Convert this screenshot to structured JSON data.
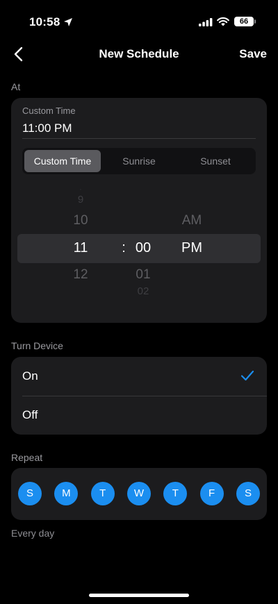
{
  "status": {
    "time": "10:58",
    "battery": "66"
  },
  "nav": {
    "title": "New Schedule",
    "save": "Save"
  },
  "at": {
    "section_label": "At",
    "field_label": "Custom Time",
    "field_value": "11:00 PM",
    "segments": [
      "Custom Time",
      "Sunrise",
      "Sunset"
    ],
    "selected_segment": 0,
    "picker": {
      "hours": [
        "9",
        "10",
        "11",
        "12"
      ],
      "minutes": [
        "00",
        "01",
        "02"
      ],
      "ampm": [
        "AM",
        "PM"
      ],
      "separator": ":"
    }
  },
  "turn": {
    "section_label": "Turn Device",
    "options": [
      "On",
      "Off"
    ],
    "selected": "On"
  },
  "repeat": {
    "section_label": "Repeat",
    "days": [
      "S",
      "M",
      "T",
      "W",
      "T",
      "F",
      "S"
    ],
    "summary": "Every day"
  },
  "colors": {
    "accent": "#1b8ef0",
    "card": "#1c1c1e",
    "background": "#000000"
  }
}
